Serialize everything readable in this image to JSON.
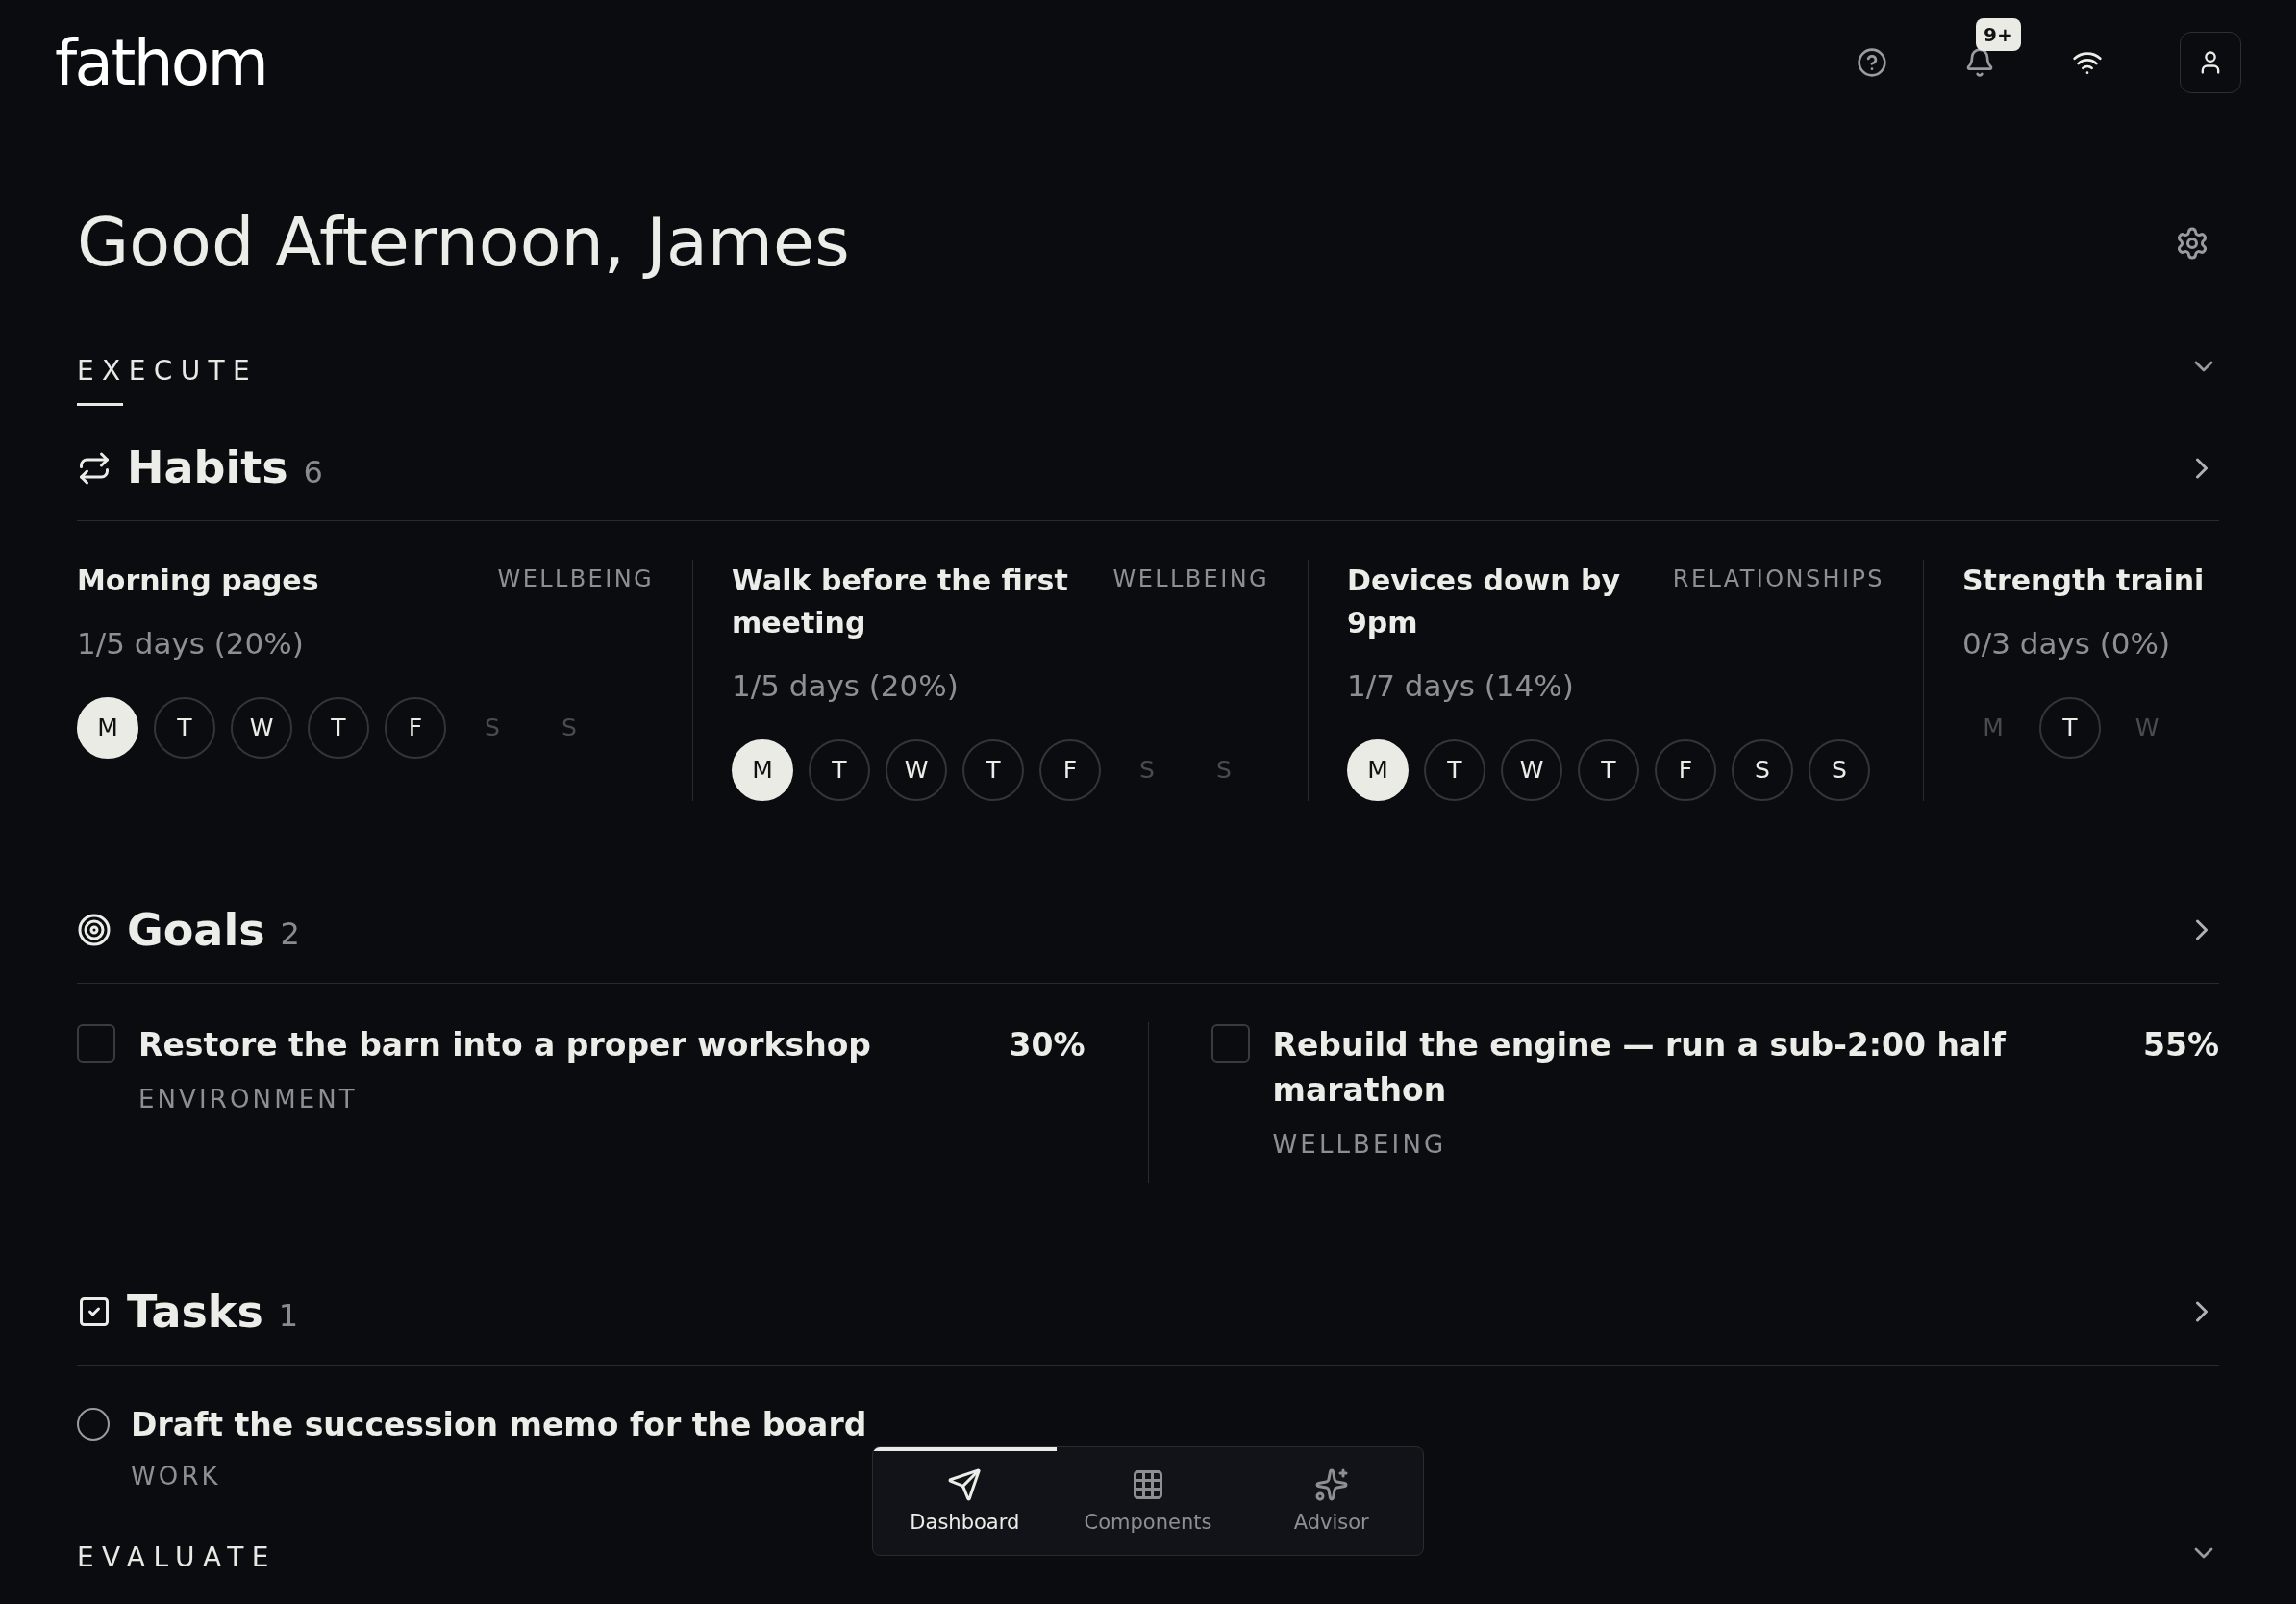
{
  "header": {
    "logo": "fathom",
    "notifications_badge": "9+"
  },
  "greeting": "Good Afternoon, James",
  "sections": [
    {
      "label": "EXECUTE"
    },
    {
      "label": "EVALUATE"
    }
  ],
  "habits": {
    "title": "Habits",
    "count": "6",
    "items": [
      {
        "name": "Morning pages",
        "tag": "WELLBEING",
        "progress": "1/5 days (20%)",
        "days": [
          {
            "label": "M",
            "kind": "done"
          },
          {
            "label": "T",
            "kind": "scheduled"
          },
          {
            "label": "W",
            "kind": "scheduled"
          },
          {
            "label": "T",
            "kind": "scheduled"
          },
          {
            "label": "F",
            "kind": "scheduled"
          },
          {
            "label": "S",
            "kind": "off"
          },
          {
            "label": "S",
            "kind": "off"
          }
        ]
      },
      {
        "name": "Walk before the first meeting",
        "tag": "WELLBEING",
        "progress": "1/5 days (20%)",
        "days": [
          {
            "label": "M",
            "kind": "done"
          },
          {
            "label": "T",
            "kind": "scheduled"
          },
          {
            "label": "W",
            "kind": "scheduled"
          },
          {
            "label": "T",
            "kind": "scheduled"
          },
          {
            "label": "F",
            "kind": "scheduled"
          },
          {
            "label": "S",
            "kind": "off"
          },
          {
            "label": "S",
            "kind": "off"
          }
        ]
      },
      {
        "name": "Devices down by 9pm",
        "tag": "RELATIONSHIPS",
        "progress": "1/7 days (14%)",
        "days": [
          {
            "label": "M",
            "kind": "done"
          },
          {
            "label": "T",
            "kind": "scheduled"
          },
          {
            "label": "W",
            "kind": "scheduled"
          },
          {
            "label": "T",
            "kind": "scheduled"
          },
          {
            "label": "F",
            "kind": "scheduled"
          },
          {
            "label": "S",
            "kind": "scheduled"
          },
          {
            "label": "S",
            "kind": "scheduled"
          }
        ]
      },
      {
        "name": "Strength traini",
        "progress": "0/3 days (0%)",
        "days": [
          {
            "label": "M",
            "kind": "off"
          },
          {
            "label": "T",
            "kind": "scheduled"
          },
          {
            "label": "W",
            "kind": "off"
          }
        ]
      }
    ]
  },
  "goals": {
    "title": "Goals",
    "count": "2",
    "items": [
      {
        "name": "Restore the barn into a proper workshop",
        "tag": "ENVIRONMENT",
        "percent": "30%",
        "checked": false
      },
      {
        "name": "Rebuild the engine — run a sub-2:00 half marathon",
        "tag": "WELLBEING",
        "percent": "55%",
        "checked": false
      }
    ]
  },
  "tasks": {
    "title": "Tasks",
    "count": "1",
    "items": [
      {
        "name": "Draft the succession memo for the board",
        "tag": "WORK",
        "done": false
      }
    ]
  },
  "bottom_nav": [
    {
      "label": "Dashboard",
      "selected": true,
      "kind": "send"
    },
    {
      "label": "Components",
      "selected": false,
      "kind": "grid"
    },
    {
      "label": "Advisor",
      "selected": false,
      "kind": "sparkle"
    }
  ]
}
